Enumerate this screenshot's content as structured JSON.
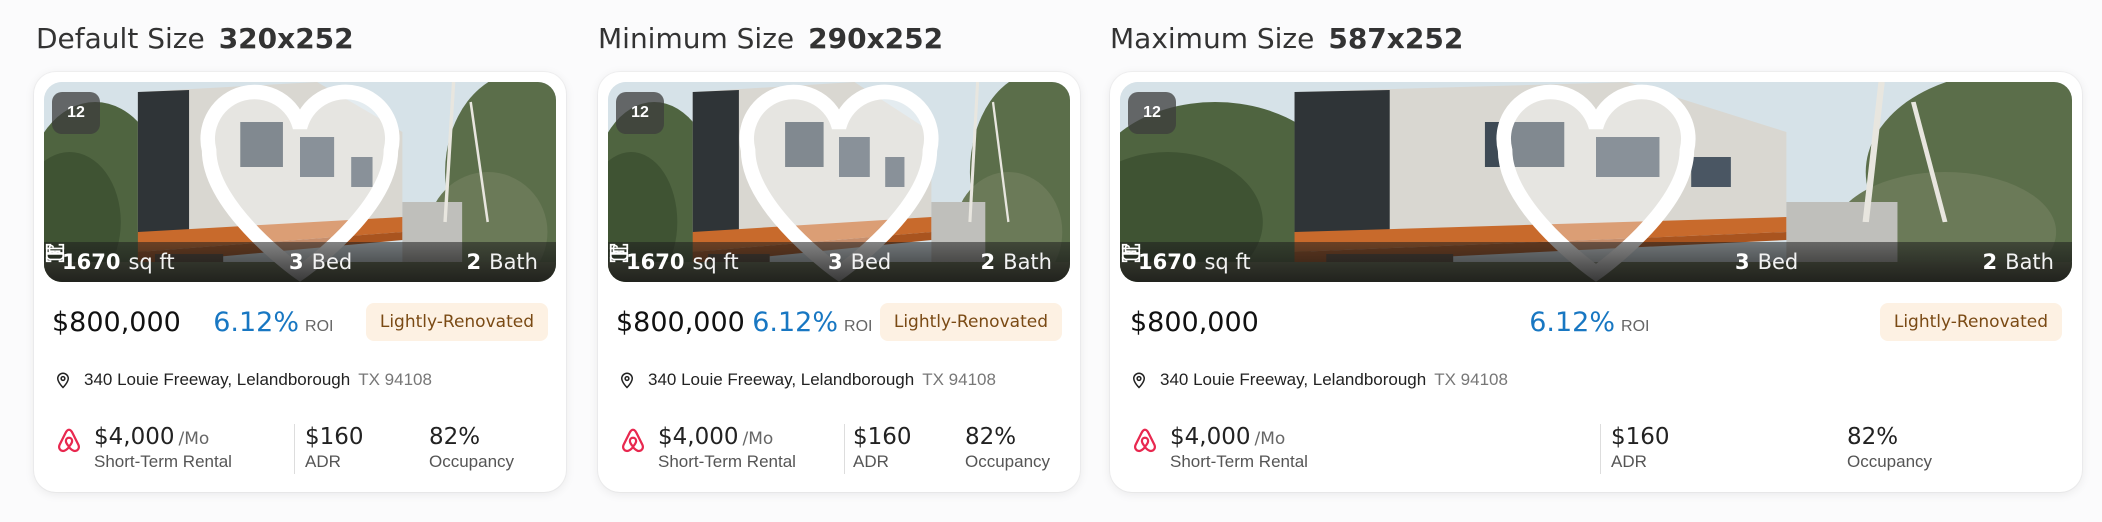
{
  "sections": [
    {
      "label": "Default Size",
      "dims": "320x252"
    },
    {
      "label": "Minimum Size",
      "dims": "290x252"
    },
    {
      "label": "Maximum Size",
      "dims": "587x252"
    }
  ],
  "listing": {
    "photo_count": "12",
    "sqft_value": "1670",
    "sqft_unit": "sq ft",
    "bed_value": "3",
    "bed_unit": "Bed",
    "bath_value": "2",
    "bath_unit": "Bath",
    "price": "$800,000",
    "roi_pct": "6.12%",
    "roi_label": "ROI",
    "renovation": "Lightly-Renovated",
    "address": "340 Louie Freeway, Lelandborough",
    "state_zip": "TX 94108",
    "rent": "$4,000",
    "rent_period": "/Mo",
    "rent_label": "Short-Term Rental",
    "adr_value": "$160",
    "adr_label": "ADR",
    "occupancy_value": "82%",
    "occupancy_label": "Occupancy"
  },
  "icons": {
    "expand": "expand-icon",
    "bed": "bed-icon",
    "bath": "bathtub-icon",
    "heart": "heart-icon",
    "location": "location-pin-icon",
    "airbnb": "airbnb-logo-icon"
  },
  "colors": {
    "roi_blue": "#1877c2",
    "airbnb_red": "#e8284f",
    "reno_bg": "#fdf1e3",
    "reno_text": "#7a4a14"
  }
}
